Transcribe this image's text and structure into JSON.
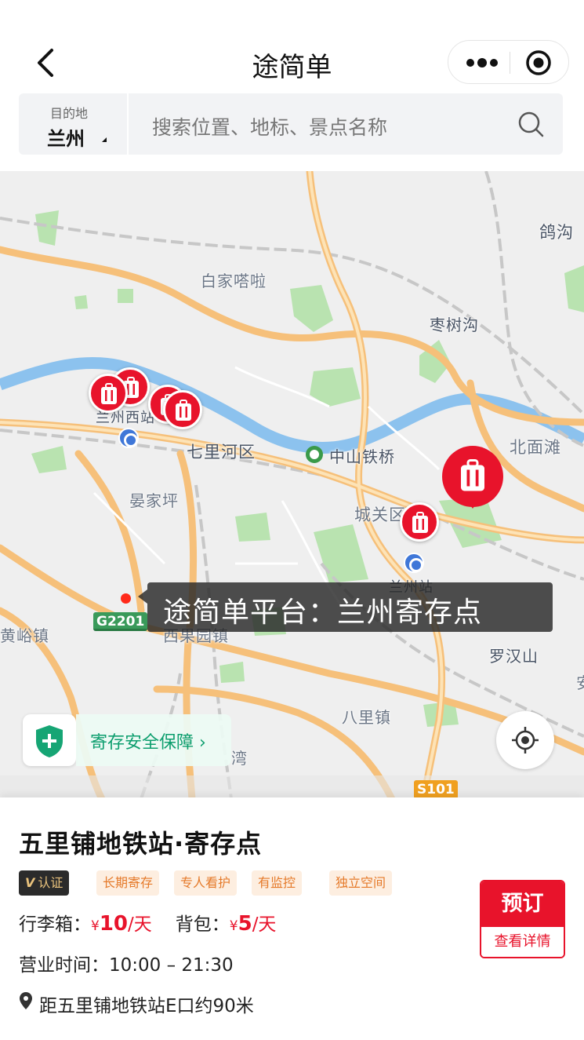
{
  "header": {
    "title": "途简单"
  },
  "search": {
    "destination_label": "目的地",
    "destination_city": "兰州",
    "placeholder": "搜索位置、地标、景点名称"
  },
  "map": {
    "place_labels": {
      "geigou": "鸽沟",
      "baijiaheli": "白家嗒啦",
      "zaoshugou": "枣树沟",
      "lanzhou_west": "兰州西站",
      "qilihe": "七里河区",
      "zhongshan_bridge": "中山铁桥",
      "beimiantan": "北面滩",
      "yanjiaping": "晏家坪",
      "chengguan": "城关区",
      "lanzhou_station": "兰州站",
      "huangyu": "黄峪镇",
      "xiguoyuan": "西果园镇",
      "luohanshan": "罗汉山",
      "balizhen": "八里镇",
      "wan": "湾",
      "an": "安"
    },
    "road_badges": {
      "g2201": "G2201",
      "s101": "S101"
    },
    "callout": "途简单平台：兰州寄存点",
    "safety_label": "寄存安全保障 ›"
  },
  "shop": {
    "name": "五里铺地铁站·寄存点",
    "tags": [
      "认证",
      "长期寄存",
      "专人看护",
      "有监控",
      "独立空间"
    ],
    "luggage_label": "行李箱：",
    "luggage_yen": "¥",
    "luggage_price": "10",
    "luggage_unit": "/天",
    "backpack_label": "背包：",
    "backpack_yen": "¥",
    "backpack_price": "5",
    "backpack_unit": "/天",
    "hours": "营业时间：10:00 – 21:30",
    "distance": "距五里铺地铁站E口约90米",
    "book_label": "预订",
    "details_label": "查看详情"
  },
  "colors": {
    "accent_red": "#e8132b",
    "safety_green": "#0d9e6e",
    "tag_orange": "#e57a2a"
  }
}
